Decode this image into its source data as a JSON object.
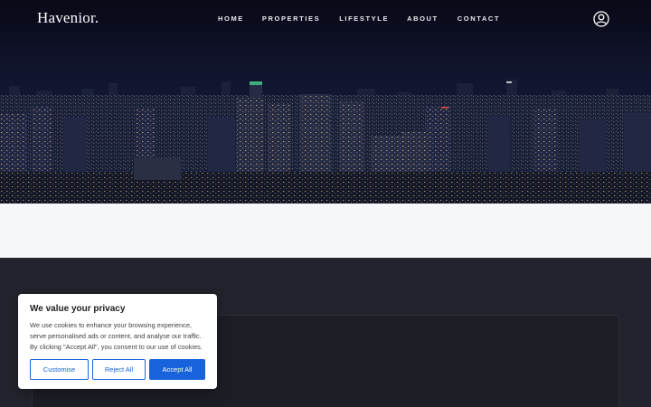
{
  "brand": {
    "logo": "Havenior."
  },
  "nav": {
    "items": [
      "HOME",
      "PROPERTIES",
      "LIFESTYLE",
      "ABOUT",
      "CONTACT"
    ]
  },
  "icons": {
    "account": "user-circle-icon"
  },
  "colors": {
    "accent": "#1863dc",
    "dark_bg": "#22242d",
    "light_band": "#f5f7fa"
  },
  "cookie": {
    "title": "We value your privacy",
    "line1": "We use cookies to enhance your browsing experience,",
    "line2": "serve personalised ads or content, and analyse our traffic.",
    "line3": "By clicking \"Accept All\", you consent to our use of cookies.",
    "customise": "Customise",
    "reject": "Reject All",
    "accept": "Accept All"
  }
}
